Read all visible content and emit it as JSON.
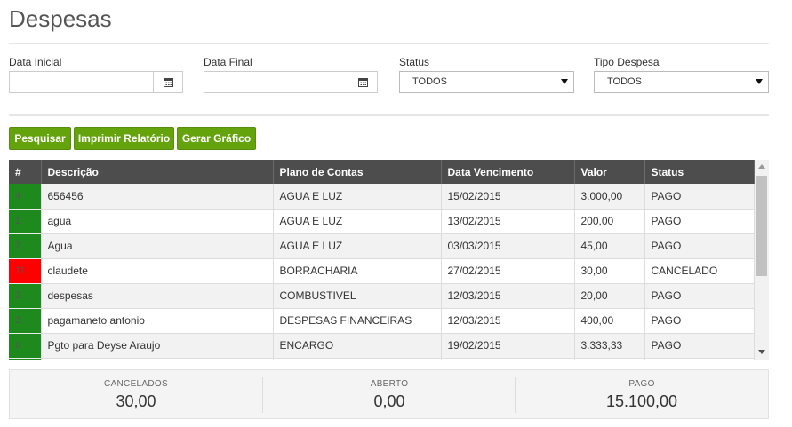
{
  "page": {
    "title": "Despesas"
  },
  "filters": {
    "data_inicial": {
      "label": "Data Inicial",
      "value": ""
    },
    "data_final": {
      "label": "Data Final",
      "value": ""
    },
    "status": {
      "label": "Status",
      "selected": "TODOS"
    },
    "tipo_despesa": {
      "label": "Tipo Despesa",
      "selected": "TODOS"
    }
  },
  "buttons": {
    "pesquisar": "Pesquisar",
    "imprimir": "Imprimir Relatório",
    "gerar": "Gerar Gráfico"
  },
  "table": {
    "columns": [
      "#",
      "Descrição",
      "Plano de Contas",
      "Data Vencimento",
      "Valor",
      "Status"
    ],
    "rows": [
      {
        "id": "4",
        "descricao": "656456",
        "plano": "AGUA E LUZ",
        "vencimento": "15/02/2015",
        "valor": "3.000,00",
        "status": "PAGO",
        "status_color": "#1e8a1e"
      },
      {
        "id": "1",
        "descricao": "agua",
        "plano": "AGUA E LUZ",
        "vencimento": "13/02/2015",
        "valor": "200,00",
        "status": "PAGO",
        "status_color": "#1e8a1e"
      },
      {
        "id": "7",
        "descricao": "Agua",
        "plano": "AGUA E LUZ",
        "vencimento": "03/03/2015",
        "valor": "45,00",
        "status": "PAGO",
        "status_color": "#1e8a1e"
      },
      {
        "id": "11",
        "descricao": "claudete",
        "plano": "BORRACHARIA",
        "vencimento": "27/02/2015",
        "valor": "30,00",
        "status": "CANCELADO",
        "status_color": "#ff0000"
      },
      {
        "id": "2",
        "descricao": "despesas",
        "plano": "COMBUSTIVEL",
        "vencimento": "12/03/2015",
        "valor": "20,00",
        "status": "PAGO",
        "status_color": "#1e8a1e"
      },
      {
        "id": "3",
        "descricao": "pagamaneto antonio",
        "plano": "DESPESAS FINANCEIRAS",
        "vencimento": "12/03/2015",
        "valor": "400,00",
        "status": "PAGO",
        "status_color": "#1e8a1e"
      },
      {
        "id": "6",
        "descricao": "Pgto para Deyse Araujo",
        "plano": "ENCARGO",
        "vencimento": "19/02/2015",
        "valor": "3.333,33",
        "status": "PAGO",
        "status_color": "#1e8a1e"
      },
      {
        "id": "9",
        "descricao": "",
        "plano": "",
        "vencimento": "",
        "valor": "",
        "status": "",
        "status_color": "#1e8a1e"
      }
    ]
  },
  "summary": {
    "cancelados": {
      "label": "CANCELADOS",
      "value": "30,00"
    },
    "aberto": {
      "label": "ABERTO",
      "value": "0,00"
    },
    "pago": {
      "label": "PAGO",
      "value": "15.100,00"
    }
  },
  "colors": {
    "accent_button": "#65a30d",
    "header_bg": "#4d4d4d",
    "paid": "#1e8a1e",
    "cancelled": "#ff0000"
  }
}
